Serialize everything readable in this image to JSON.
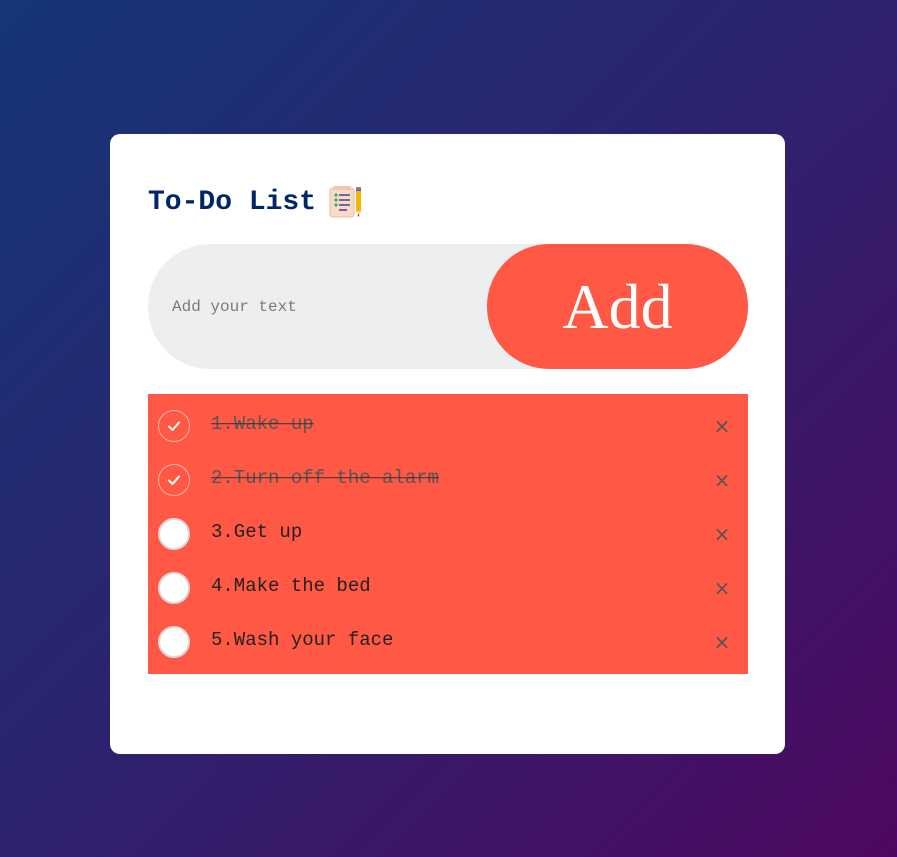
{
  "app": {
    "title": "To-Do List",
    "title_icon": "notepad-icon"
  },
  "input": {
    "placeholder": "Add your text",
    "value": ""
  },
  "add_button": {
    "label": "Add"
  },
  "tasks": [
    {
      "text": "1.Wake up",
      "done": true
    },
    {
      "text": "2.Turn off the alarm",
      "done": true
    },
    {
      "text": "3.Get up",
      "done": false
    },
    {
      "text": "4.Make the bed",
      "done": false
    },
    {
      "text": "5.Wash your face",
      "done": false
    }
  ],
  "remove_glyph": "×",
  "colors": {
    "accent": "#ff5945",
    "title": "#002765",
    "input_bg": "#edeef0",
    "bg_start": "#153677",
    "bg_end": "#4e085f"
  }
}
